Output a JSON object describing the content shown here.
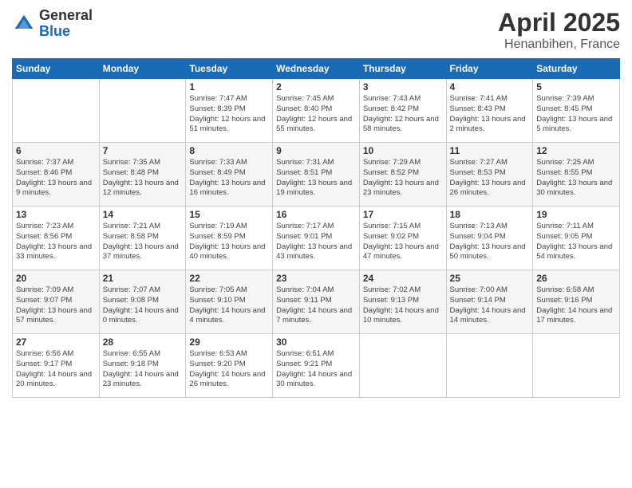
{
  "logo": {
    "general": "General",
    "blue": "Blue"
  },
  "title": "April 2025",
  "location": "Henanbihen, France",
  "days_of_week": [
    "Sunday",
    "Monday",
    "Tuesday",
    "Wednesday",
    "Thursday",
    "Friday",
    "Saturday"
  ],
  "weeks": [
    [
      {
        "day": "",
        "sunrise": "",
        "sunset": "",
        "daylight": ""
      },
      {
        "day": "",
        "sunrise": "",
        "sunset": "",
        "daylight": ""
      },
      {
        "day": "1",
        "sunrise": "Sunrise: 7:47 AM",
        "sunset": "Sunset: 8:39 PM",
        "daylight": "Daylight: 12 hours and 51 minutes."
      },
      {
        "day": "2",
        "sunrise": "Sunrise: 7:45 AM",
        "sunset": "Sunset: 8:40 PM",
        "daylight": "Daylight: 12 hours and 55 minutes."
      },
      {
        "day": "3",
        "sunrise": "Sunrise: 7:43 AM",
        "sunset": "Sunset: 8:42 PM",
        "daylight": "Daylight: 12 hours and 58 minutes."
      },
      {
        "day": "4",
        "sunrise": "Sunrise: 7:41 AM",
        "sunset": "Sunset: 8:43 PM",
        "daylight": "Daylight: 13 hours and 2 minutes."
      },
      {
        "day": "5",
        "sunrise": "Sunrise: 7:39 AM",
        "sunset": "Sunset: 8:45 PM",
        "daylight": "Daylight: 13 hours and 5 minutes."
      }
    ],
    [
      {
        "day": "6",
        "sunrise": "Sunrise: 7:37 AM",
        "sunset": "Sunset: 8:46 PM",
        "daylight": "Daylight: 13 hours and 9 minutes."
      },
      {
        "day": "7",
        "sunrise": "Sunrise: 7:35 AM",
        "sunset": "Sunset: 8:48 PM",
        "daylight": "Daylight: 13 hours and 12 minutes."
      },
      {
        "day": "8",
        "sunrise": "Sunrise: 7:33 AM",
        "sunset": "Sunset: 8:49 PM",
        "daylight": "Daylight: 13 hours and 16 minutes."
      },
      {
        "day": "9",
        "sunrise": "Sunrise: 7:31 AM",
        "sunset": "Sunset: 8:51 PM",
        "daylight": "Daylight: 13 hours and 19 minutes."
      },
      {
        "day": "10",
        "sunrise": "Sunrise: 7:29 AM",
        "sunset": "Sunset: 8:52 PM",
        "daylight": "Daylight: 13 hours and 23 minutes."
      },
      {
        "day": "11",
        "sunrise": "Sunrise: 7:27 AM",
        "sunset": "Sunset: 8:53 PM",
        "daylight": "Daylight: 13 hours and 26 minutes."
      },
      {
        "day": "12",
        "sunrise": "Sunrise: 7:25 AM",
        "sunset": "Sunset: 8:55 PM",
        "daylight": "Daylight: 13 hours and 30 minutes."
      }
    ],
    [
      {
        "day": "13",
        "sunrise": "Sunrise: 7:23 AM",
        "sunset": "Sunset: 8:56 PM",
        "daylight": "Daylight: 13 hours and 33 minutes."
      },
      {
        "day": "14",
        "sunrise": "Sunrise: 7:21 AM",
        "sunset": "Sunset: 8:58 PM",
        "daylight": "Daylight: 13 hours and 37 minutes."
      },
      {
        "day": "15",
        "sunrise": "Sunrise: 7:19 AM",
        "sunset": "Sunset: 8:59 PM",
        "daylight": "Daylight: 13 hours and 40 minutes."
      },
      {
        "day": "16",
        "sunrise": "Sunrise: 7:17 AM",
        "sunset": "Sunset: 9:01 PM",
        "daylight": "Daylight: 13 hours and 43 minutes."
      },
      {
        "day": "17",
        "sunrise": "Sunrise: 7:15 AM",
        "sunset": "Sunset: 9:02 PM",
        "daylight": "Daylight: 13 hours and 47 minutes."
      },
      {
        "day": "18",
        "sunrise": "Sunrise: 7:13 AM",
        "sunset": "Sunset: 9:04 PM",
        "daylight": "Daylight: 13 hours and 50 minutes."
      },
      {
        "day": "19",
        "sunrise": "Sunrise: 7:11 AM",
        "sunset": "Sunset: 9:05 PM",
        "daylight": "Daylight: 13 hours and 54 minutes."
      }
    ],
    [
      {
        "day": "20",
        "sunrise": "Sunrise: 7:09 AM",
        "sunset": "Sunset: 9:07 PM",
        "daylight": "Daylight: 13 hours and 57 minutes."
      },
      {
        "day": "21",
        "sunrise": "Sunrise: 7:07 AM",
        "sunset": "Sunset: 9:08 PM",
        "daylight": "Daylight: 14 hours and 0 minutes."
      },
      {
        "day": "22",
        "sunrise": "Sunrise: 7:05 AM",
        "sunset": "Sunset: 9:10 PM",
        "daylight": "Daylight: 14 hours and 4 minutes."
      },
      {
        "day": "23",
        "sunrise": "Sunrise: 7:04 AM",
        "sunset": "Sunset: 9:11 PM",
        "daylight": "Daylight: 14 hours and 7 minutes."
      },
      {
        "day": "24",
        "sunrise": "Sunrise: 7:02 AM",
        "sunset": "Sunset: 9:13 PM",
        "daylight": "Daylight: 14 hours and 10 minutes."
      },
      {
        "day": "25",
        "sunrise": "Sunrise: 7:00 AM",
        "sunset": "Sunset: 9:14 PM",
        "daylight": "Daylight: 14 hours and 14 minutes."
      },
      {
        "day": "26",
        "sunrise": "Sunrise: 6:58 AM",
        "sunset": "Sunset: 9:16 PM",
        "daylight": "Daylight: 14 hours and 17 minutes."
      }
    ],
    [
      {
        "day": "27",
        "sunrise": "Sunrise: 6:56 AM",
        "sunset": "Sunset: 9:17 PM",
        "daylight": "Daylight: 14 hours and 20 minutes."
      },
      {
        "day": "28",
        "sunrise": "Sunrise: 6:55 AM",
        "sunset": "Sunset: 9:18 PM",
        "daylight": "Daylight: 14 hours and 23 minutes."
      },
      {
        "day": "29",
        "sunrise": "Sunrise: 6:53 AM",
        "sunset": "Sunset: 9:20 PM",
        "daylight": "Daylight: 14 hours and 26 minutes."
      },
      {
        "day": "30",
        "sunrise": "Sunrise: 6:51 AM",
        "sunset": "Sunset: 9:21 PM",
        "daylight": "Daylight: 14 hours and 30 minutes."
      },
      {
        "day": "",
        "sunrise": "",
        "sunset": "",
        "daylight": ""
      },
      {
        "day": "",
        "sunrise": "",
        "sunset": "",
        "daylight": ""
      },
      {
        "day": "",
        "sunrise": "",
        "sunset": "",
        "daylight": ""
      }
    ]
  ]
}
